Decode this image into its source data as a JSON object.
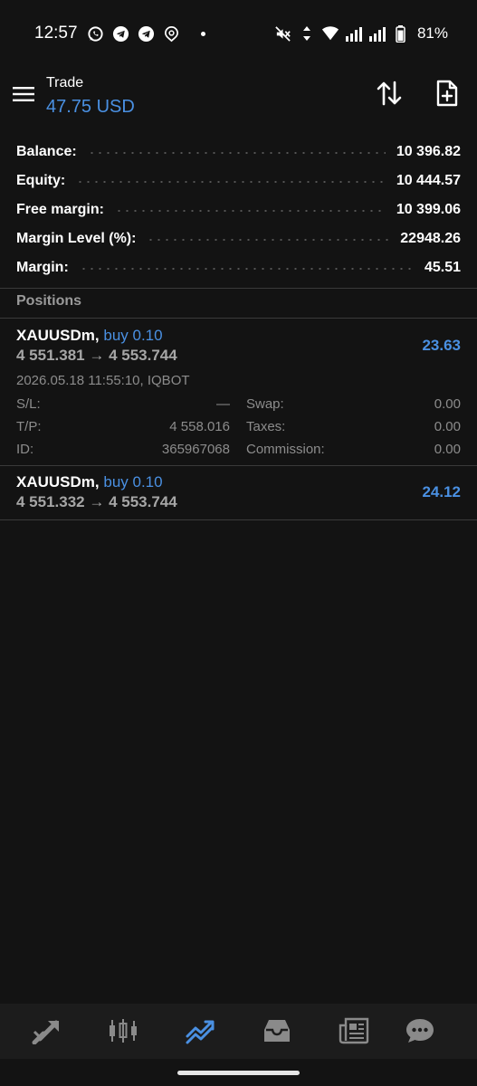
{
  "status_bar": {
    "time": "12:57",
    "battery": "81%"
  },
  "header": {
    "title": "Trade",
    "subtitle": "47.75 USD"
  },
  "account": [
    {
      "label": "Balance:",
      "value": "10 396.82"
    },
    {
      "label": "Equity:",
      "value": "10 444.57"
    },
    {
      "label": "Free margin:",
      "value": "10 399.06"
    },
    {
      "label": "Margin Level (%):",
      "value": "22948.26"
    },
    {
      "label": "Margin:",
      "value": "45.51"
    }
  ],
  "positions_label": "Positions",
  "positions": [
    {
      "symbol": "XAUUSDm,",
      "side": "buy 0.10",
      "prices": "4 551.381 → 4 553.744",
      "profit": "23.63",
      "time": "2026.05.18 11:55:10, IQBOT",
      "sl_label": "S/L:",
      "sl_value": "—",
      "tp_label": "T/P:",
      "tp_value": "4 558.016",
      "id_label": "ID:",
      "id_value": "365967068",
      "swap_label": "Swap:",
      "swap_value": "0.00",
      "taxes_label": "Taxes:",
      "taxes_value": "0.00",
      "commission_label": "Commission:",
      "commission_value": "0.00"
    },
    {
      "symbol": "XAUUSDm,",
      "side": "buy 0.10",
      "prices": "4 551.332 → 4 553.744",
      "profit": "24.12"
    }
  ],
  "icons": {
    "menu": "hamburger-icon",
    "sort": "sort-arrows-icon",
    "new_order": "new-document-icon",
    "nav": [
      "quotes-icon",
      "chart-icon",
      "trade-icon",
      "history-icon",
      "news-icon",
      "chat-icon"
    ]
  },
  "colors": {
    "background": "#131313",
    "accent": "#4a90e2",
    "nav_background": "#1c1c1c",
    "muted_text": "#8c8c8c"
  }
}
